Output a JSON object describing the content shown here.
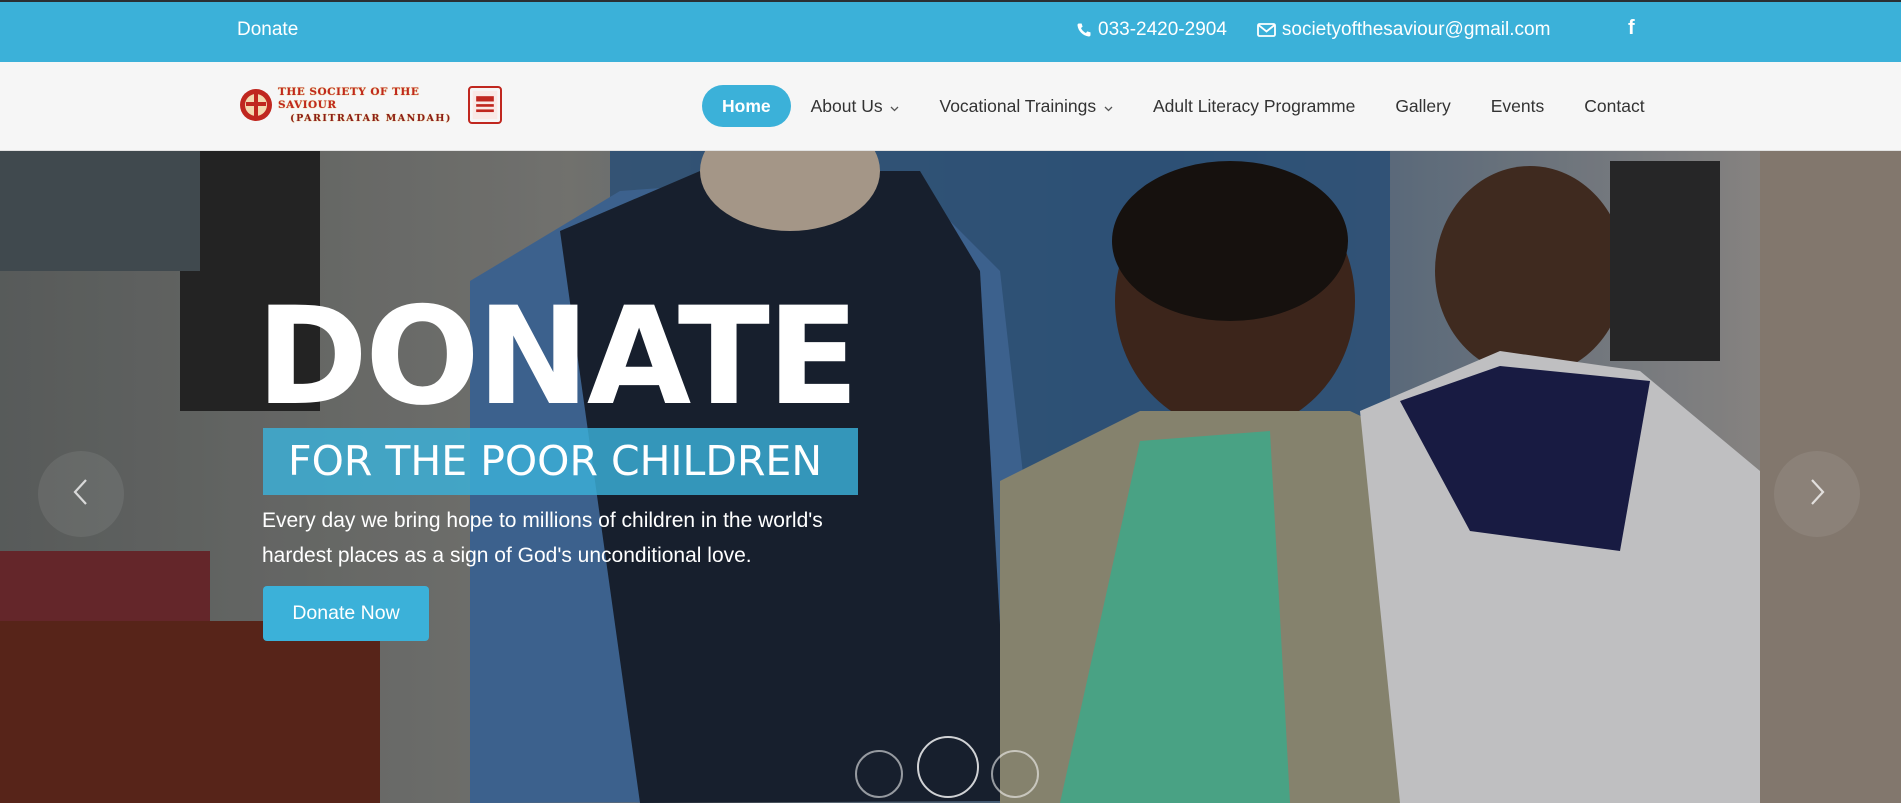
{
  "topbar": {
    "donate_link": "Donate",
    "phone": "033-2420-2904",
    "email": "societyofthesaviour@gmail.com",
    "social_icon": "facebook-icon",
    "social_glyph": "f"
  },
  "logo": {
    "line1": "THE SOCIETY OF THE SAVIOUR",
    "line2": "(PARITRATAR MANDAH)"
  },
  "nav": {
    "items": [
      {
        "label": "Home",
        "active": true,
        "dropdown": false
      },
      {
        "label": "About Us",
        "active": false,
        "dropdown": true
      },
      {
        "label": "Vocational Trainings",
        "active": false,
        "dropdown": true
      },
      {
        "label": "Adult Literacy Programme",
        "active": false,
        "dropdown": false
      },
      {
        "label": "Gallery",
        "active": false,
        "dropdown": false
      },
      {
        "label": "Events",
        "active": false,
        "dropdown": false
      },
      {
        "label": "Contact",
        "active": false,
        "dropdown": false
      }
    ]
  },
  "hero": {
    "title": "DONATE",
    "subtitle": "FOR THE POOR CHILDREN",
    "text": "Every day we bring hope to millions of children in the world's hardest places as a sign of God's unconditional love.",
    "button": "Donate Now"
  },
  "colors": {
    "accent": "#3bb1d9",
    "nav_bg": "#f6f6f6",
    "text_dark": "#333333",
    "logo_red": "#c0271f"
  }
}
